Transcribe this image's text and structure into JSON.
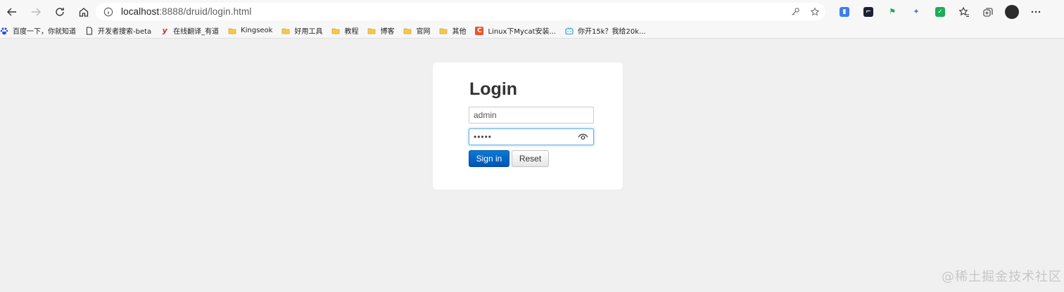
{
  "browser": {
    "url_host": "localhost",
    "url_rest": ":8888/druid/login.html",
    "bookmarks": [
      {
        "label": "百度一下，你就知道",
        "icon": "baidu-icon"
      },
      {
        "label": "开发者搜索-beta",
        "icon": "page-icon"
      },
      {
        "label": "在线翻译_有道",
        "icon": "youdao-icon"
      },
      {
        "label": "Kingseok",
        "icon": "folder-icon"
      },
      {
        "label": "好用工具",
        "icon": "folder-icon"
      },
      {
        "label": "教程",
        "icon": "folder-icon"
      },
      {
        "label": "博客",
        "icon": "folder-icon"
      },
      {
        "label": "官网",
        "icon": "folder-icon"
      },
      {
        "label": "其他",
        "icon": "folder-icon"
      },
      {
        "label": "Linux下Mycat安装...",
        "icon": "csdn-icon"
      },
      {
        "label": "你开15k？我给20k...",
        "icon": "bilibili-icon"
      }
    ]
  },
  "login": {
    "title": "Login",
    "username_value": "admin",
    "password_mask": "•••••",
    "signin_label": "Sign in",
    "reset_label": "Reset"
  },
  "watermark": "@稀土掘金技术社区",
  "colors": {
    "page_bg": "#f0f0f0",
    "primary_button": "#0066c8",
    "focus_border": "#66afe9"
  }
}
